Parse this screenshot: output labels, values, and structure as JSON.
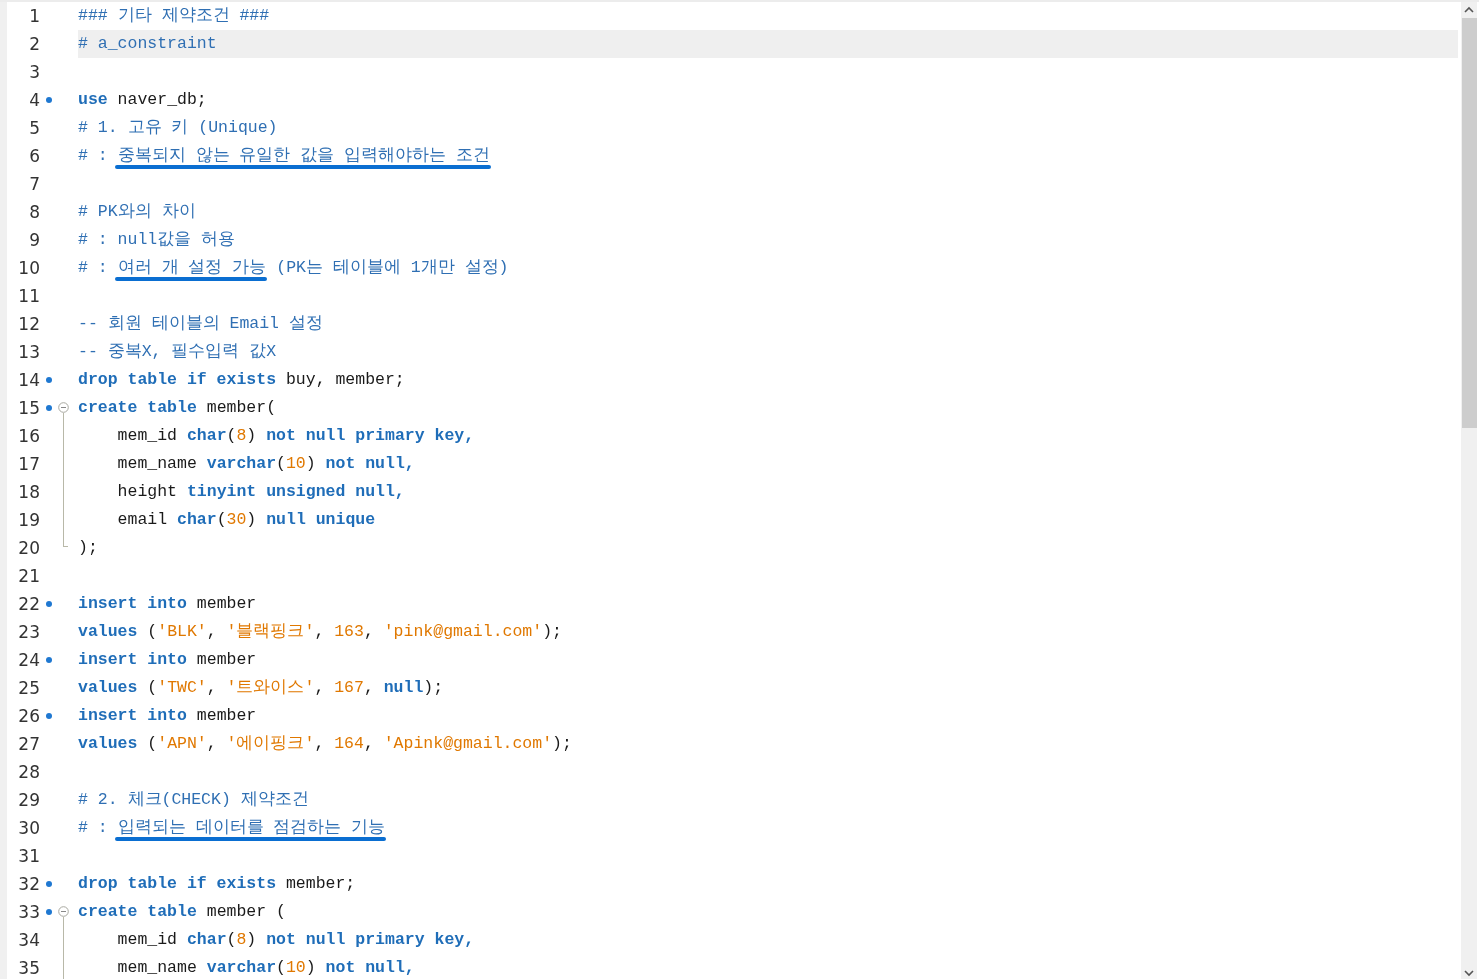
{
  "editor": {
    "lines": [
      {
        "number": "1",
        "marker": false,
        "kind": "plain",
        "current": false,
        "tokens": [
          {
            "kind": "comment",
            "text": "### 기타 제약조건 ###"
          }
        ]
      },
      {
        "number": "2",
        "marker": false,
        "kind": "plain",
        "current": true,
        "tokens": [
          {
            "kind": "comment",
            "text": "# a_constraint"
          }
        ]
      },
      {
        "number": "3",
        "marker": false,
        "kind": "plain",
        "current": false
      },
      {
        "number": "4",
        "marker": true,
        "kind": "plain",
        "current": false,
        "tokens": [
          {
            "kind": "keyword",
            "text": "use"
          },
          {
            "kind": "plain",
            "text": " naver_db;"
          }
        ]
      },
      {
        "number": "5",
        "marker": false,
        "kind": "plain",
        "current": false,
        "tokens": [
          {
            "kind": "comment",
            "text": "# 1. 고유 키 (Unique)"
          }
        ]
      },
      {
        "number": "6",
        "marker": false,
        "kind": "plain",
        "current": false,
        "tokens": [
          {
            "kind": "comment",
            "text": "# : "
          },
          {
            "kind": "underlined_comment",
            "text": "중복되지 않는 유일한 값을 입력해야하는 조건"
          }
        ]
      },
      {
        "number": "7",
        "marker": false,
        "kind": "plain",
        "current": false
      },
      {
        "number": "8",
        "marker": false,
        "kind": "plain",
        "current": false,
        "tokens": [
          {
            "kind": "comment",
            "text": "# PK와의 차이"
          }
        ]
      },
      {
        "number": "9",
        "marker": false,
        "kind": "plain",
        "current": false,
        "tokens": [
          {
            "kind": "comment",
            "text": "# : null값을 허용"
          }
        ]
      },
      {
        "number": "10",
        "marker": false,
        "kind": "plain",
        "current": false,
        "tokens": [
          {
            "kind": "comment",
            "text": "# : "
          },
          {
            "kind": "underlined_comment",
            "text": "여러 개 설정 가능"
          },
          {
            "kind": "comment",
            "text": " (PK는 테이블에 1개만 설정)"
          }
        ]
      },
      {
        "number": "11",
        "marker": false,
        "kind": "plain",
        "current": false
      },
      {
        "number": "12",
        "marker": false,
        "kind": "plain",
        "current": false,
        "tokens": [
          {
            "kind": "comment",
            "text": "-- 회원 테이블의 Email 설정"
          }
        ]
      },
      {
        "number": "13",
        "marker": false,
        "kind": "plain",
        "current": false,
        "tokens": [
          {
            "kind": "comment",
            "text": "-- 중복X, 필수입력 값X"
          }
        ]
      },
      {
        "number": "14",
        "marker": true,
        "kind": "plain",
        "current": false,
        "tokens": [
          {
            "kind": "keyword",
            "text": "drop table if exists"
          },
          {
            "kind": "plain",
            "text": " buy, member;"
          }
        ]
      },
      {
        "number": "15",
        "marker": true,
        "kind": "fold_start",
        "current": false,
        "tokens": [
          {
            "kind": "keyword",
            "text": "create table"
          },
          {
            "kind": "plain",
            "text": " member("
          }
        ]
      },
      {
        "number": "16",
        "marker": false,
        "kind": "fold_body",
        "current": false,
        "tokens": [
          {
            "kind": "plain",
            "text": "    mem_id "
          },
          {
            "kind": "keyword",
            "text": "char"
          },
          {
            "kind": "plain",
            "text": "("
          },
          {
            "kind": "literal",
            "text": "8"
          },
          {
            "kind": "plain",
            "text": ") "
          },
          {
            "kind": "keyword",
            "text": "not null primary key,"
          }
        ]
      },
      {
        "number": "17",
        "marker": false,
        "kind": "fold_body",
        "current": false,
        "tokens": [
          {
            "kind": "plain",
            "text": "    mem_name "
          },
          {
            "kind": "keyword",
            "text": "varchar"
          },
          {
            "kind": "plain",
            "text": "("
          },
          {
            "kind": "literal",
            "text": "10"
          },
          {
            "kind": "plain",
            "text": ") "
          },
          {
            "kind": "keyword",
            "text": "not null,"
          }
        ]
      },
      {
        "number": "18",
        "marker": false,
        "kind": "fold_body",
        "current": false,
        "tokens": [
          {
            "kind": "plain",
            "text": "    height "
          },
          {
            "kind": "keyword",
            "text": "tinyint unsigned null,"
          }
        ]
      },
      {
        "number": "19",
        "marker": false,
        "kind": "fold_body",
        "current": false,
        "tokens": [
          {
            "kind": "plain",
            "text": "    email "
          },
          {
            "kind": "keyword",
            "text": "char"
          },
          {
            "kind": "plain",
            "text": "("
          },
          {
            "kind": "literal",
            "text": "30"
          },
          {
            "kind": "plain",
            "text": ") "
          },
          {
            "kind": "keyword",
            "text": "null unique"
          }
        ]
      },
      {
        "number": "20",
        "marker": false,
        "kind": "fold_end",
        "current": false,
        "tokens": [
          {
            "kind": "plain",
            "text": ");"
          }
        ]
      },
      {
        "number": "21",
        "marker": false,
        "kind": "plain",
        "current": false
      },
      {
        "number": "22",
        "marker": true,
        "kind": "plain",
        "current": false,
        "tokens": [
          {
            "kind": "keyword",
            "text": "insert into"
          },
          {
            "kind": "plain",
            "text": " member"
          }
        ]
      },
      {
        "number": "23",
        "marker": false,
        "kind": "plain",
        "current": false,
        "tokens": [
          {
            "kind": "keyword",
            "text": "values"
          },
          {
            "kind": "plain",
            "text": " ("
          },
          {
            "kind": "literal",
            "text": "'BLK'"
          },
          {
            "kind": "plain",
            "text": ", "
          },
          {
            "kind": "literal",
            "text": "'블랙핑크'"
          },
          {
            "kind": "plain",
            "text": ", "
          },
          {
            "kind": "literal",
            "text": "163"
          },
          {
            "kind": "plain",
            "text": ", "
          },
          {
            "kind": "literal",
            "text": "'pink@gmail.com'"
          },
          {
            "kind": "plain",
            "text": ");"
          }
        ]
      },
      {
        "number": "24",
        "marker": true,
        "kind": "plain",
        "current": false,
        "tokens": [
          {
            "kind": "keyword",
            "text": "insert into"
          },
          {
            "kind": "plain",
            "text": " member"
          }
        ]
      },
      {
        "number": "25",
        "marker": false,
        "kind": "plain",
        "current": false,
        "tokens": [
          {
            "kind": "keyword",
            "text": "values"
          },
          {
            "kind": "plain",
            "text": " ("
          },
          {
            "kind": "literal",
            "text": "'TWC'"
          },
          {
            "kind": "plain",
            "text": ", "
          },
          {
            "kind": "literal",
            "text": "'트와이스'"
          },
          {
            "kind": "plain",
            "text": ", "
          },
          {
            "kind": "literal",
            "text": "167"
          },
          {
            "kind": "plain",
            "text": ", "
          },
          {
            "kind": "keyword",
            "text": "null"
          },
          {
            "kind": "plain",
            "text": ");"
          }
        ]
      },
      {
        "number": "26",
        "marker": true,
        "kind": "plain",
        "current": false,
        "tokens": [
          {
            "kind": "keyword",
            "text": "insert into"
          },
          {
            "kind": "plain",
            "text": " member"
          }
        ]
      },
      {
        "number": "27",
        "marker": false,
        "kind": "plain",
        "current": false,
        "tokens": [
          {
            "kind": "keyword",
            "text": "values"
          },
          {
            "kind": "plain",
            "text": " ("
          },
          {
            "kind": "literal",
            "text": "'APN'"
          },
          {
            "kind": "plain",
            "text": ", "
          },
          {
            "kind": "literal",
            "text": "'에이핑크'"
          },
          {
            "kind": "plain",
            "text": ", "
          },
          {
            "kind": "literal",
            "text": "164"
          },
          {
            "kind": "plain",
            "text": ", "
          },
          {
            "kind": "literal",
            "text": "'Apink@gmail.com'"
          },
          {
            "kind": "plain",
            "text": ");"
          }
        ]
      },
      {
        "number": "28",
        "marker": false,
        "kind": "plain",
        "current": false
      },
      {
        "number": "29",
        "marker": false,
        "kind": "plain",
        "current": false,
        "tokens": [
          {
            "kind": "comment",
            "text": "# 2. 체크(CHECK) 제약조건"
          }
        ]
      },
      {
        "number": "30",
        "marker": false,
        "kind": "plain",
        "current": false,
        "tokens": [
          {
            "kind": "comment",
            "text": "# : "
          },
          {
            "kind": "underlined_comment",
            "text": "입력되는 데이터를 점검하는 기능"
          }
        ]
      },
      {
        "number": "31",
        "marker": false,
        "kind": "plain",
        "current": false
      },
      {
        "number": "32",
        "marker": true,
        "kind": "plain",
        "current": false,
        "tokens": [
          {
            "kind": "keyword",
            "text": "drop table if exists"
          },
          {
            "kind": "plain",
            "text": " member;"
          }
        ]
      },
      {
        "number": "33",
        "marker": true,
        "kind": "fold_start",
        "current": false,
        "tokens": [
          {
            "kind": "keyword",
            "text": "create table"
          },
          {
            "kind": "plain",
            "text": " member ("
          }
        ]
      },
      {
        "number": "34",
        "marker": false,
        "kind": "fold_body",
        "current": false,
        "tokens": [
          {
            "kind": "plain",
            "text": "    mem_id "
          },
          {
            "kind": "keyword",
            "text": "char"
          },
          {
            "kind": "plain",
            "text": "("
          },
          {
            "kind": "literal",
            "text": "8"
          },
          {
            "kind": "plain",
            "text": ") "
          },
          {
            "kind": "keyword",
            "text": "not null primary key,"
          }
        ]
      },
      {
        "number": "35",
        "marker": false,
        "kind": "fold_body",
        "current": false,
        "tokens": [
          {
            "kind": "plain",
            "text": "    mem_name "
          },
          {
            "kind": "keyword",
            "text": "varchar"
          },
          {
            "kind": "plain",
            "text": "("
          },
          {
            "kind": "literal",
            "text": "10"
          },
          {
            "kind": "plain",
            "text": ") "
          },
          {
            "kind": "keyword",
            "text": "not null,"
          }
        ]
      }
    ]
  }
}
